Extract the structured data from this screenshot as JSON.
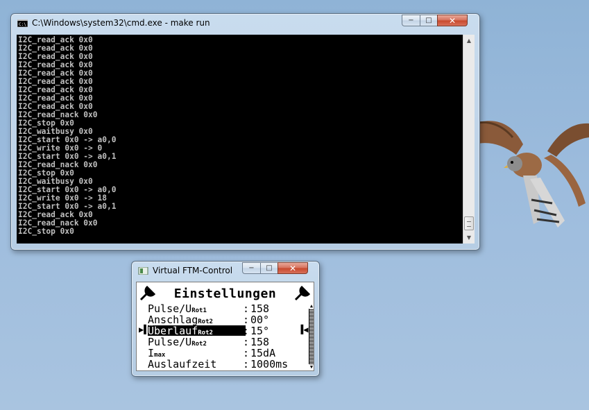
{
  "cmd_window": {
    "title": "C:\\Windows\\system32\\cmd.exe - make  run",
    "icon": "console-icon",
    "lines": [
      "I2C_read_ack 0x0",
      "I2C_read_ack 0x0",
      "I2C_read_ack 0x0",
      "I2C_read_ack 0x0",
      "I2C_read_ack 0x0",
      "I2C_read_ack 0x0",
      "I2C_read_ack 0x0",
      "I2C_read_ack 0x0",
      "I2C_read_ack 0x0",
      "I2C_read_nack 0x0",
      "I2C_stop 0x0",
      "I2C_waitbusy 0x0",
      "I2C_start 0x0 -> a0,0",
      "I2C_write 0x0 -> 0",
      "I2C_start 0x0 -> a0,1",
      "I2C_read_nack 0x0",
      "I2C_stop 0x0",
      "I2C_waitbusy 0x0",
      "I2C_start 0x0 -> a0,0",
      "I2C_write 0x0 -> 18",
      "I2C_start 0x0 -> a0,1",
      "I2C_read_ack 0x0",
      "I2C_read_nack 0x0",
      "I2C_stop 0x0"
    ]
  },
  "ftm_window": {
    "title": "Virtual FTM-Control",
    "icon": "app-icon",
    "lcd": {
      "heading": "Einstellungen",
      "rows": [
        {
          "label": "Pulse/U",
          "sub": "Rot1",
          "value": "158",
          "selected": false
        },
        {
          "label": "Anschlag",
          "sub": "Rot2",
          "value": "00°",
          "selected": false
        },
        {
          "label": "Überlauf",
          "sub": "Rot2",
          "value": "15°",
          "selected": true
        },
        {
          "label": "Pulse/U",
          "sub": "Rot2",
          "value": "158",
          "selected": false
        },
        {
          "label": "I",
          "sub": "max",
          "value": "15dA",
          "selected": false
        },
        {
          "label": "Auslaufzeit",
          "sub": "",
          "value": "1000ms",
          "selected": false
        }
      ],
      "separator": ":",
      "left_marker": "▶▌",
      "right_marker": "▐◀"
    }
  },
  "caption_buttons": {
    "minimize": "−",
    "maximize": "□",
    "close": "✕"
  }
}
